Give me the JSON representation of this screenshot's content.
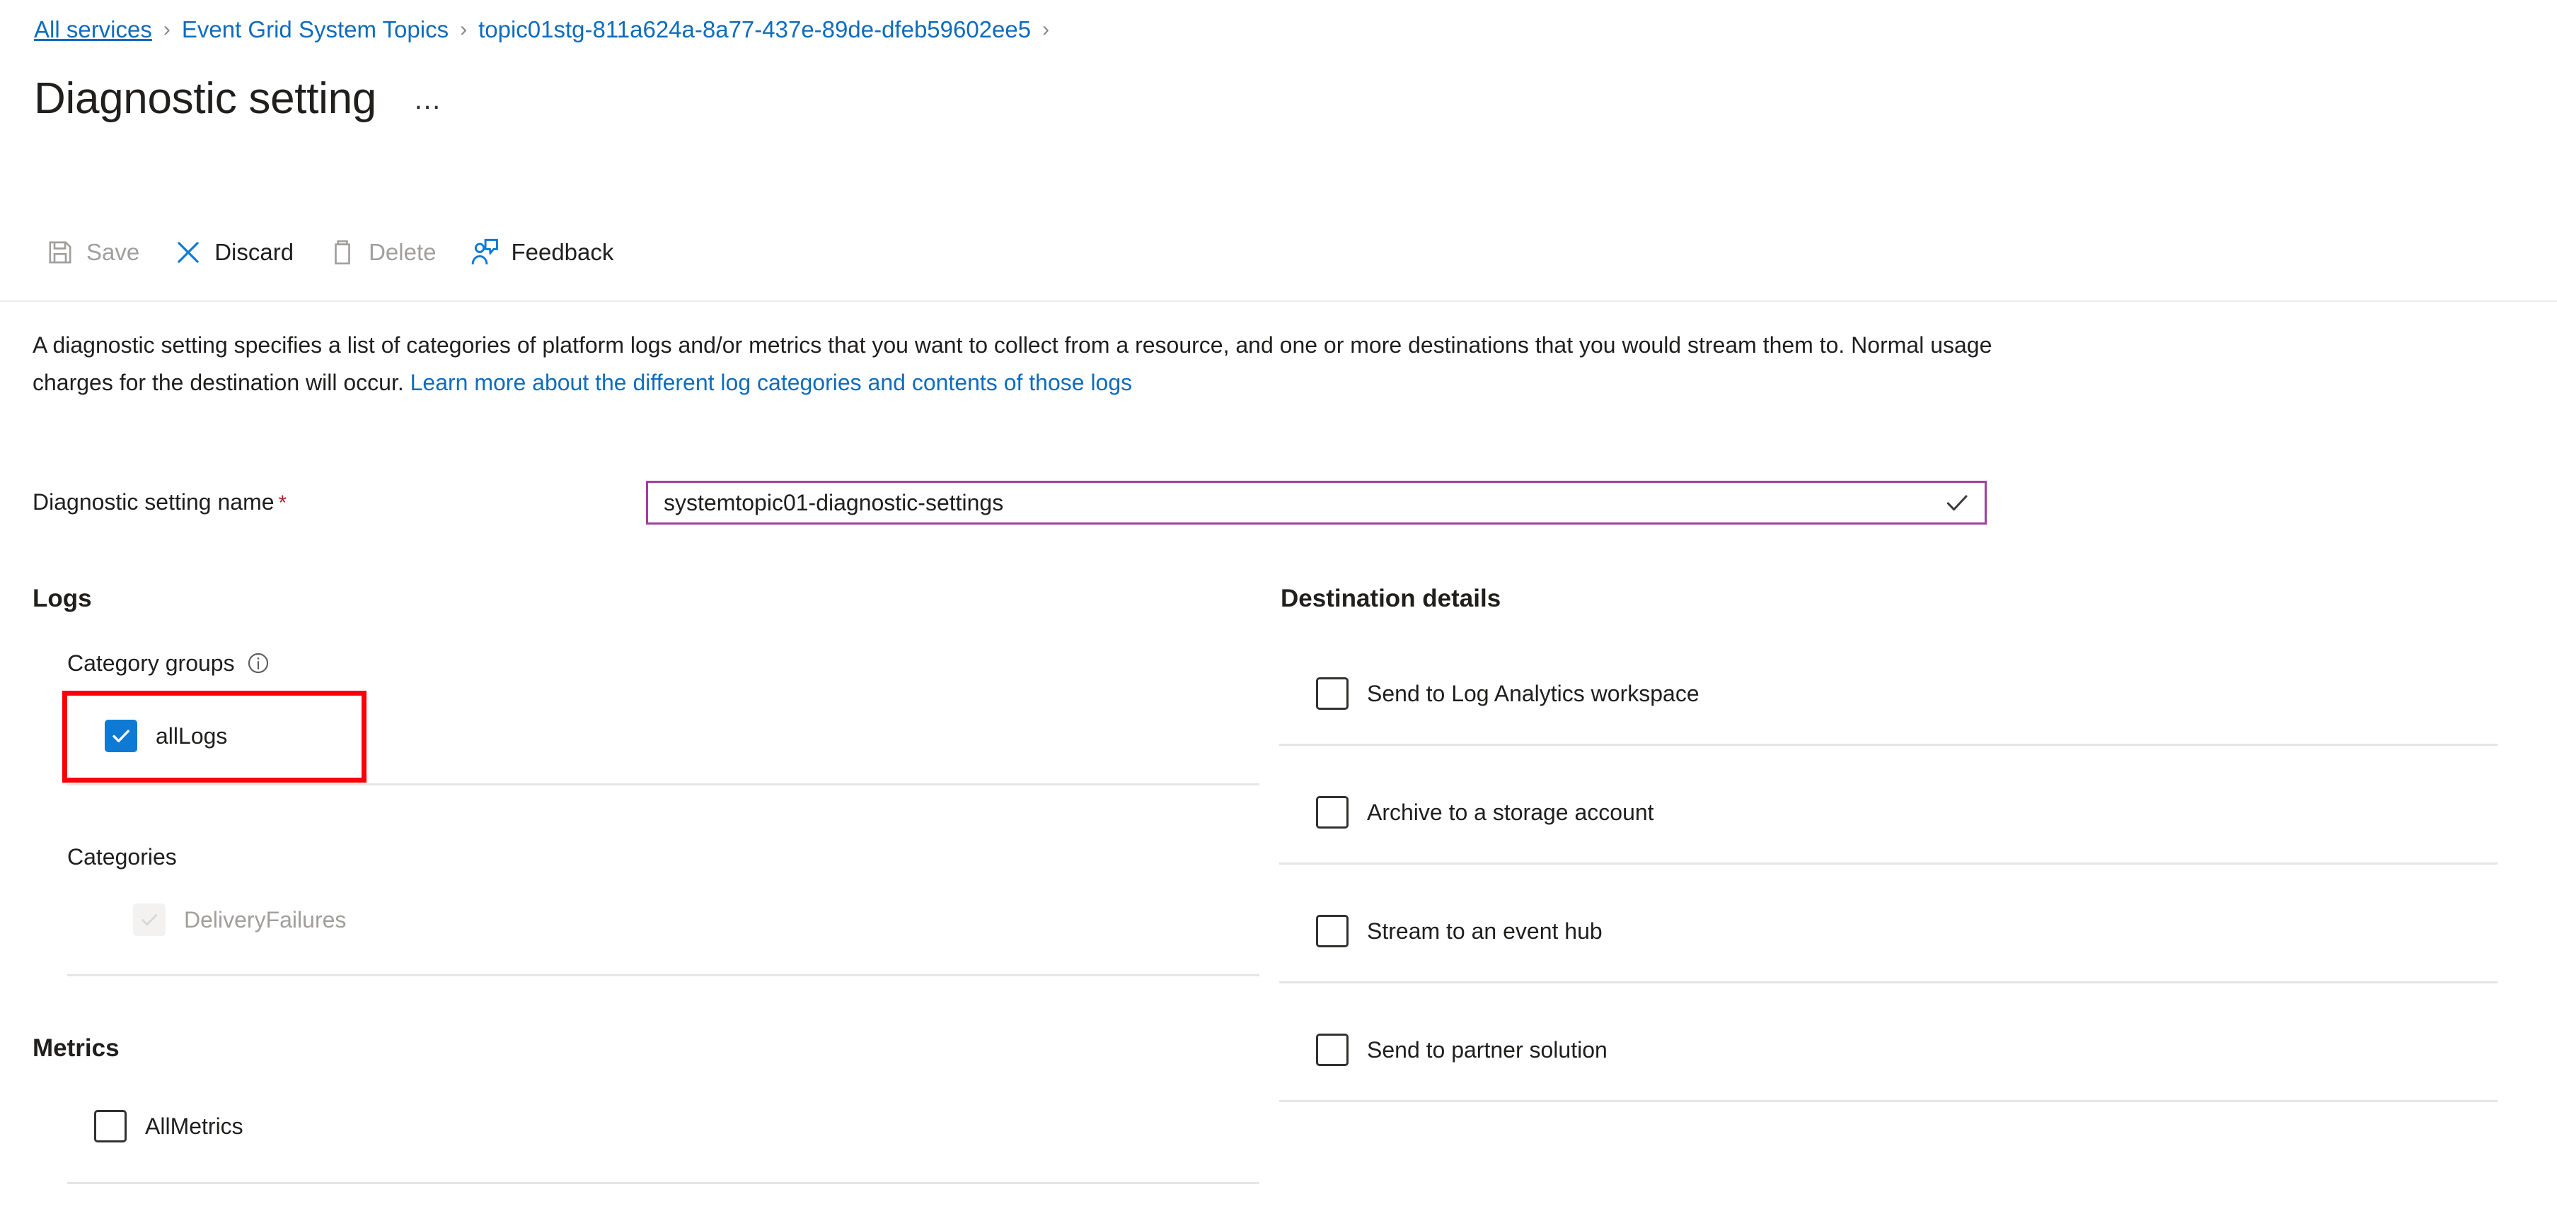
{
  "breadcrumb": {
    "items": [
      {
        "label": "All services"
      },
      {
        "label": "Event Grid System Topics"
      },
      {
        "label": "topic01stg-811a624a-8a77-437e-89de-dfeb59602ee5"
      }
    ],
    "separator": "›"
  },
  "header": {
    "title": "Diagnostic setting",
    "more_label": "…"
  },
  "toolbar": {
    "items": [
      {
        "label": "Save",
        "icon": "save-icon",
        "enabled": false
      },
      {
        "label": "Discard",
        "icon": "discard-icon",
        "enabled": true
      },
      {
        "label": "Delete",
        "icon": "delete-icon",
        "enabled": false
      },
      {
        "label": "Feedback",
        "icon": "feedback-icon",
        "enabled": true
      }
    ]
  },
  "description": {
    "part1": "A diagnostic setting specifies a list of categories of platform logs and/or metrics that you want to collect from a resource, and one or more destinations that you would stream them to. Normal usage charges for the destination will occur. ",
    "link": "Learn more about the different log categories and contents of those logs"
  },
  "name_field": {
    "label": "Diagnostic setting name",
    "required_marker": "*",
    "value": "systemtopic01-diagnostic-settings",
    "placeholder": "",
    "valid_icon": "checkmark-icon",
    "border_color": "#a33ea1"
  },
  "logs": {
    "heading": "Logs",
    "category_groups_label": "Category groups",
    "category_groups_info_icon": "info-icon",
    "category_groups": [
      {
        "label": "allLogs",
        "checked": true,
        "disabled": false
      }
    ],
    "categories_label": "Categories",
    "categories": [
      {
        "label": "DeliveryFailures",
        "checked": true,
        "disabled": true
      }
    ]
  },
  "metrics": {
    "heading": "Metrics",
    "items": [
      {
        "label": "AllMetrics",
        "checked": false,
        "disabled": false
      }
    ]
  },
  "destination": {
    "heading": "Destination details",
    "items": [
      {
        "label": "Send to Log Analytics workspace",
        "checked": false
      },
      {
        "label": "Archive to a storage account",
        "checked": false
      },
      {
        "label": "Stream to an event hub",
        "checked": false
      },
      {
        "label": "Send to partner solution",
        "checked": false
      }
    ]
  },
  "annotation": {
    "target": "allLogs-checkbox",
    "color": "#fb0007"
  },
  "colors": {
    "link": "#0f6cbd",
    "checkbox_accent": "#0f7ad4",
    "required": "#a4262c",
    "divider": "#e6e5e4",
    "highlight": "#fb0007",
    "field_border": "#a33ea1"
  }
}
